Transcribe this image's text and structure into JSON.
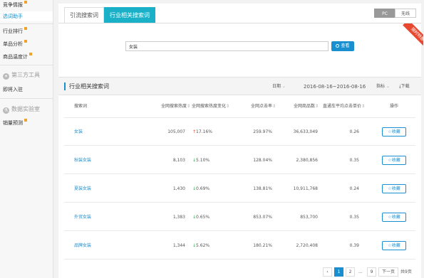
{
  "sidebar": {
    "items_top": [
      {
        "label": "竞争情报",
        "tag": true
      },
      {
        "label": "选词助手",
        "active": true
      }
    ],
    "items_mid": [
      {
        "label": "行业排行",
        "tag": true
      },
      {
        "label": "单品分析",
        "tag": true
      },
      {
        "label": "商品温度计",
        "tag": true
      }
    ],
    "group_third_party": "第三方工具",
    "item_third": "即将入驻",
    "group_lab": "数据实验室",
    "item_lab": {
      "label": "销量预测",
      "tag": true
    }
  },
  "tabs": [
    {
      "label": "引流搜索词"
    },
    {
      "label": "行业相关搜索词",
      "active": true
    }
  ],
  "device": {
    "pc": "PC",
    "wireless": "无线"
  },
  "ribbon_text": "限时特惠",
  "search": {
    "value": "女装",
    "button": "查看"
  },
  "section": {
    "title": "行业相关搜索词",
    "date_label": "日期",
    "date_range": "2016-08-16~2016-08-16",
    "metric_label": "指标",
    "download_label": "下载"
  },
  "table": {
    "headers": [
      "搜索词",
      "全网搜索热度",
      "全网搜索热度变化",
      "全网点击率",
      "全网商品数",
      "直通车平均点击单价",
      "操作"
    ],
    "fav_label": "收藏",
    "rows": [
      {
        "keyword": "女装",
        "heat": "105,007",
        "change": "17.16%",
        "dir": "up",
        "ctr": "259.97%",
        "goods": "36,633,049",
        "cpc": "0.26"
      },
      {
        "keyword": "秋装女装",
        "heat": "8,103",
        "change": "5.10%",
        "dir": "down",
        "ctr": "128.04%",
        "goods": "2,380,856",
        "cpc": "0.35"
      },
      {
        "keyword": "夏装女装",
        "heat": "1,430",
        "change": "0.69%",
        "dir": "down",
        "ctr": "138.81%",
        "goods": "10,911,768",
        "cpc": "0.24"
      },
      {
        "keyword": "外贸女装",
        "heat": "1,383",
        "change": "0.65%",
        "dir": "down",
        "ctr": "853.07%",
        "goods": "853,700",
        "cpc": "0.35"
      },
      {
        "keyword": "品牌女装",
        "heat": "1,344",
        "change": "5.62%",
        "dir": "down",
        "ctr": "180.21%",
        "goods": "2,720,408",
        "cpc": "0.39"
      }
    ]
  },
  "pagination": {
    "prev": "‹",
    "pages": [
      "1",
      "2",
      "...",
      "9"
    ],
    "next": "下一页 ›",
    "total": "共9页"
  },
  "colors": {
    "accent": "#1a8fd0",
    "tab_active": "#1ab0c8",
    "up": "#e8482f",
    "down": "#2aa84a",
    "ribbon": "#e8482f"
  },
  "icons": {
    "search": "search-icon",
    "fav": "star-icon",
    "download": "download-icon",
    "up": "arrow-up-icon",
    "down": "arrow-down-icon"
  }
}
